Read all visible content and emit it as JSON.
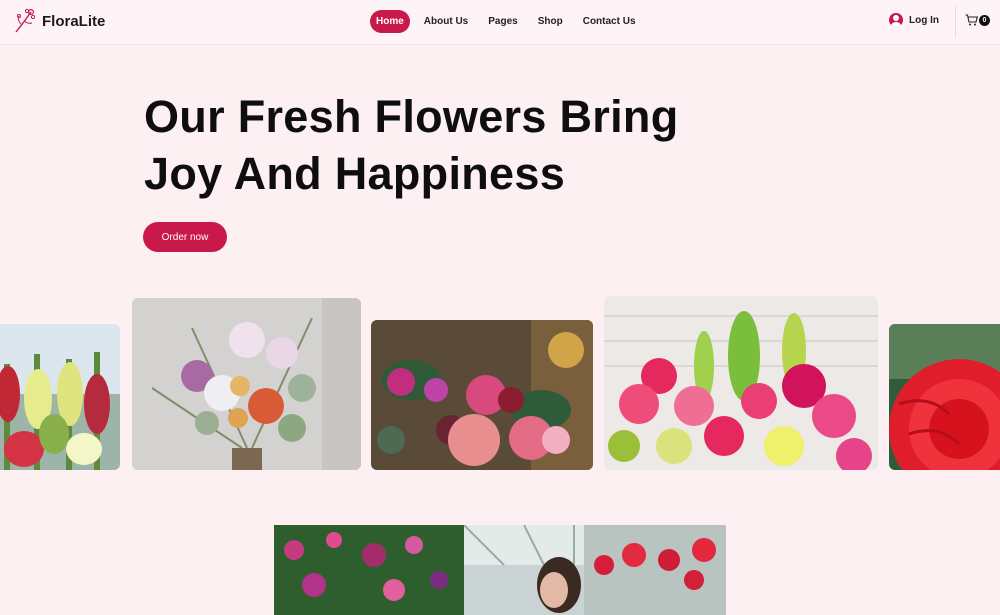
{
  "brand": {
    "name": "FloraLite"
  },
  "nav": {
    "items": [
      {
        "label": "Home",
        "active": true
      },
      {
        "label": "About Us",
        "active": false
      },
      {
        "label": "Pages",
        "active": false
      },
      {
        "label": "Shop",
        "active": false
      },
      {
        "label": "Contact Us",
        "active": false
      }
    ]
  },
  "header": {
    "login_label": "Log In",
    "cart_count": "0",
    "user_icon": "user-circle-icon",
    "cart_icon": "cart-icon"
  },
  "hero": {
    "title_line1": "Our Fresh Flowers Bring",
    "title_line2": "Joy And Happiness",
    "cta_label": "Order now"
  },
  "gallery": {
    "images": [
      "snapdragon-bouquet-photo",
      "dried-flower-bouquet-photo",
      "rose-bouquet-photo",
      "pink-flower-arrangement-photo",
      "red-dahlia-photo",
      "greenhouse-florist-photo"
    ]
  },
  "colors": {
    "accent": "#c9184a",
    "background": "#fdf0f3",
    "text": "#0e0e0e"
  }
}
